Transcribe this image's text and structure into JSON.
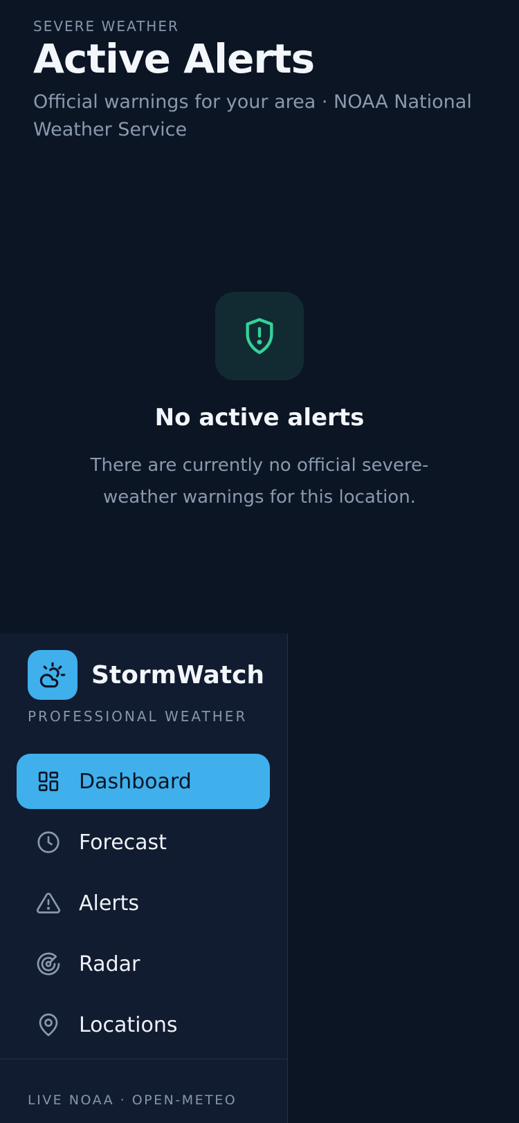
{
  "header": {
    "eyebrow": "SEVERE WEATHER",
    "title": "Active Alerts",
    "subtitle": "Official warnings for your area · NOAA National Weather Service"
  },
  "empty_state": {
    "icon": "shield-alert-icon",
    "title": "No active alerts",
    "message": "There are currently no official severe-weather warnings for this location."
  },
  "sidebar": {
    "brand_name": "StormWatch",
    "brand_icon": "cloud-sun-icon",
    "tagline": "PROFESSIONAL WEATHER",
    "items": [
      {
        "label": "Dashboard",
        "icon": "dashboard-icon",
        "active": true
      },
      {
        "label": "Forecast",
        "icon": "clock-icon",
        "active": false
      },
      {
        "label": "Alerts",
        "icon": "warning-triangle-icon",
        "active": false
      },
      {
        "label": "Radar",
        "icon": "radar-icon",
        "active": false
      },
      {
        "label": "Locations",
        "icon": "map-pin-icon",
        "active": false
      }
    ],
    "footer": "LIVE NOAA · OPEN-METEO"
  },
  "colors": {
    "background": "#0c1524",
    "sidebar": "#111c30",
    "accent": "#3fb0ec",
    "success": "#34d399"
  }
}
